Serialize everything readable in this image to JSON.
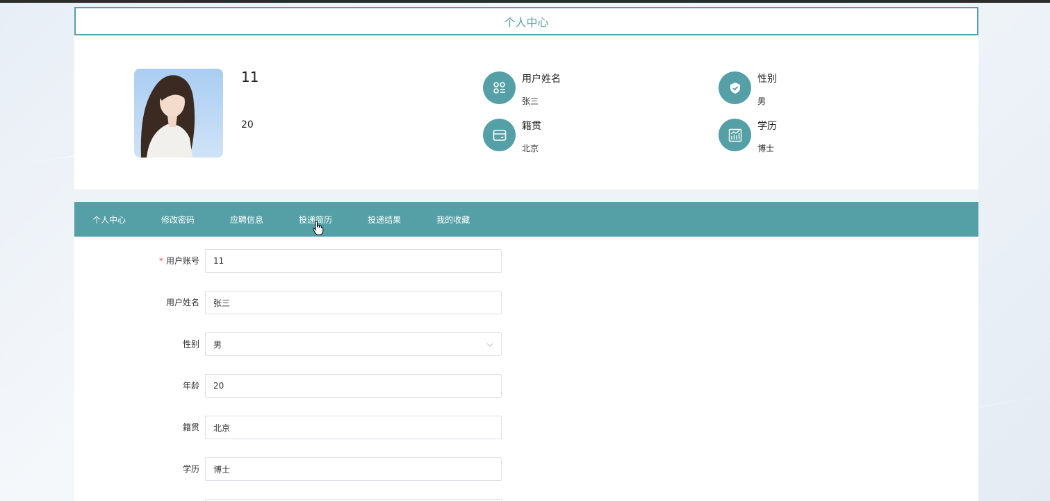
{
  "page": {
    "title": "个人中心"
  },
  "profile": {
    "username": "11",
    "age": "20",
    "info": [
      {
        "label": "用户姓名",
        "value": "张三",
        "icon": "user-card-icon"
      },
      {
        "label": "性别",
        "value": "男",
        "icon": "shield-check-icon"
      },
      {
        "label": "籍贯",
        "value": "北京",
        "icon": "wallet-icon"
      },
      {
        "label": "学历",
        "value": "博士",
        "icon": "chart-icon"
      }
    ]
  },
  "tabs": [
    {
      "label": "个人中心"
    },
    {
      "label": "修改密码"
    },
    {
      "label": "应聘信息"
    },
    {
      "label": "投递简历"
    },
    {
      "label": "投递结果"
    },
    {
      "label": "我的收藏"
    }
  ],
  "form": {
    "fields": [
      {
        "label": "用户账号",
        "value": "11",
        "required": true
      },
      {
        "label": "用户姓名",
        "value": "张三",
        "required": false
      },
      {
        "label": "性别",
        "value": "男",
        "required": false,
        "type": "select"
      },
      {
        "label": "年龄",
        "value": "20",
        "required": false
      },
      {
        "label": "籍贯",
        "value": "北京",
        "required": false
      },
      {
        "label": "学历",
        "value": "博士",
        "required": false
      },
      {
        "label": "",
        "value": "",
        "required": false
      }
    ]
  },
  "colors": {
    "accent": "#54a0a6",
    "required": "#e0584c"
  }
}
